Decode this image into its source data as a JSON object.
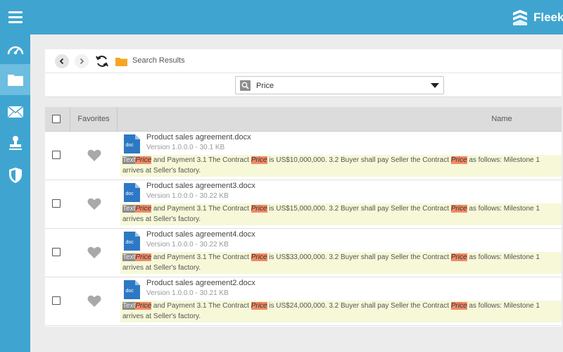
{
  "header": {
    "brand_name": "Fleekd",
    "menu_icon": "hamburger-icon",
    "brand_icon": "fleekdrive-logo-icon",
    "accent_color": "#3fa5d0"
  },
  "sidebar": {
    "items": [
      {
        "name": "dashboard",
        "icon": "speedometer-icon",
        "active": false
      },
      {
        "name": "files",
        "icon": "folder-icon",
        "active": true
      },
      {
        "name": "messages",
        "icon": "envelope-icon",
        "active": false
      },
      {
        "name": "approvals",
        "icon": "stamp-icon",
        "active": false
      },
      {
        "name": "security",
        "icon": "shield-icon",
        "active": false
      }
    ]
  },
  "toolbar": {
    "breadcrumb": "Search Results",
    "back_icon": "chevron-left-icon",
    "forward_icon": "chevron-right-icon",
    "refresh_icon": "refresh-icon"
  },
  "search": {
    "value": "Price",
    "icon": "search-icon",
    "dropdown_icon": "caret-down-icon"
  },
  "table": {
    "columns": {
      "favorites": "Favorites",
      "name": "Name"
    },
    "rows": [
      {
        "file_name": "Product sales agreement.docx",
        "meta": "Version 1.0.0.0 - 30.1 KB",
        "doc_label": "doc",
        "snippet": {
          "prefix": "Text",
          "term": "Price",
          "part1": " and Payment 3.1 The Contract ",
          "part2": " is US$10,000,000. 3.2 Buyer shall pay Seller the Contract ",
          "part3": " as follows: Milestone 1",
          "line2": "arrives at Seller's factory."
        }
      },
      {
        "file_name": "Product sales agreement3.docx",
        "meta": "Version 1.0.0.0 - 30.22 KB",
        "doc_label": "doc",
        "snippet": {
          "prefix": "Text",
          "term": "Price",
          "part1": " and Payment 3.1 The Contract ",
          "part2": " is US$15,000,000. 3.2 Buyer shall pay Seller the Contract ",
          "part3": " as follows: Milestone 1",
          "line2": "arrives at Seller's factory."
        }
      },
      {
        "file_name": "Product sales agreement4.docx",
        "meta": "Version 1.0.0.0 - 30.22 KB",
        "doc_label": "doc",
        "snippet": {
          "prefix": "Text",
          "term": "Price",
          "part1": " and Payment 3.1 The Contract ",
          "part2": " is US$33,000,000. 3.2 Buyer shall pay Seller the Contract ",
          "part3": " as follows: Milestone 1",
          "line2": "arrives at Seller's factory."
        }
      },
      {
        "file_name": "Product sales agreement2.docx",
        "meta": "Version 1.0.0.0 - 30.21 KB",
        "doc_label": "doc",
        "snippet": {
          "prefix": "Text",
          "term": "Price",
          "part1": " and Payment 3.1 The Contract ",
          "part2": " is US$24,000,000. 3.2 Buyer shall pay Seller the Contract ",
          "part3": " as follows: Milestone 1",
          "line2": "arrives at Seller's factory."
        }
      }
    ]
  }
}
